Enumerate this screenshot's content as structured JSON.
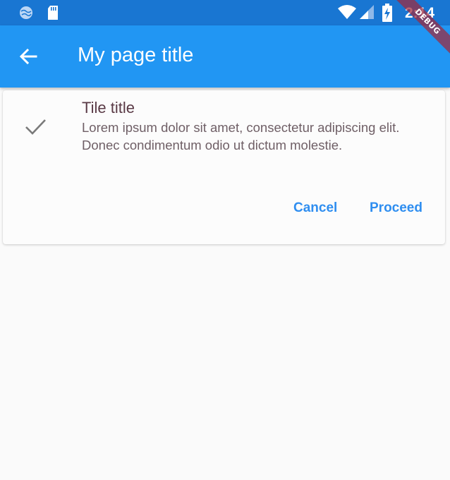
{
  "status_bar": {
    "time": "2:14",
    "icons": [
      "globe-icon",
      "sd-card-icon",
      "wifi-icon",
      "signal-icon",
      "battery-charging-icon"
    ],
    "background_color": "#1976d2"
  },
  "debug_banner": {
    "label": "DEBUG"
  },
  "app_bar": {
    "title": "My page title",
    "back_icon": "arrow-back-icon",
    "background_color": "#2196f3"
  },
  "card": {
    "leading_icon": "check-icon",
    "title": "Tile title",
    "subtitle": "Lorem ipsum dolor sit amet, consectetur adipiscing elit. Donec condimentum odio ut dictum molestie.",
    "actions": {
      "cancel_label": "Cancel",
      "proceed_label": "Proceed"
    },
    "action_color": "#2f8ef0"
  }
}
